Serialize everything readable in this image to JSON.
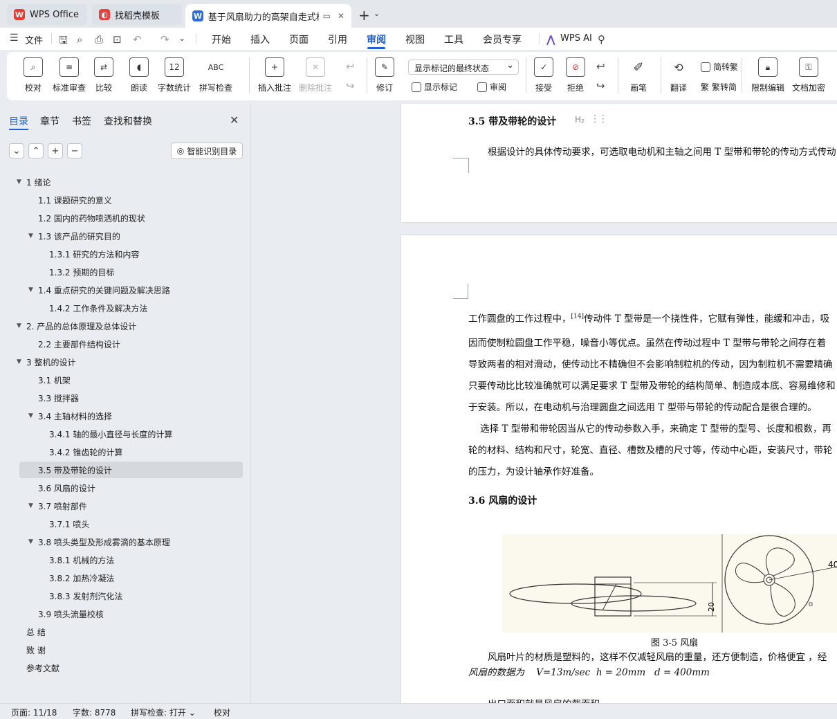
{
  "tabs": [
    {
      "label": "WPS Office"
    },
    {
      "label": "找稻壳模板"
    },
    {
      "label": "基于风扇助力的高架自走式棉花"
    }
  ],
  "menubar": {
    "file": "文件",
    "items": [
      "开始",
      "插入",
      "页面",
      "引用",
      "审阅",
      "视图",
      "工具",
      "会员专享"
    ],
    "active": "审阅",
    "ai": "WPS AI"
  },
  "ribbon": {
    "proofread": "校对",
    "std_review": "标准审查",
    "compare": "比较",
    "read_aloud": "朗读",
    "word_count": "字数统计",
    "spell_check": "拼写检查",
    "insert_comment": "插入批注",
    "delete_comment": "删除批注",
    "track": "修订",
    "markup_select": "显示标记的最终状态",
    "show_markup": "显示标记",
    "review": "审阅",
    "accept": "接受",
    "reject": "拒绝",
    "pen": "画笔",
    "translate": "翻译",
    "to_trad": "简转繁",
    "to_simp": "繁转简",
    "restrict": "限制编辑",
    "encrypt": "文档加密",
    "trad_icon_text": "繁",
    "count_icon_text": "12",
    "abc_icon_text": "ABC"
  },
  "nav": {
    "tabs": [
      "目录",
      "章节",
      "书签",
      "查找和替换"
    ],
    "smart_toc": "智能识别目录",
    "toc": [
      {
        "label": "1  绪论",
        "level": 0,
        "twisty": true
      },
      {
        "label": "1.1 课题研究的意义",
        "level": 1,
        "twisty": false
      },
      {
        "label": "1.2 国内的药物喷洒机的现状",
        "level": 1,
        "twisty": false
      },
      {
        "label": "1.3  该产品的研究目的",
        "level": 1,
        "twisty": true
      },
      {
        "label": "1.3.1  研究的方法和内容",
        "level": 2,
        "twisty": false
      },
      {
        "label": "1.3.2 预期的目标",
        "level": 2,
        "twisty": false
      },
      {
        "label": "1.4 重点研究的关键问题及解决思路",
        "level": 1,
        "twisty": true
      },
      {
        "label": "1.4.2 工作条件及解决方法",
        "level": 2,
        "twisty": false
      },
      {
        "label": "2.  产品的总体原理及总体设计",
        "level": 0,
        "twisty": true
      },
      {
        "label": "2.2  主要部件结构设计",
        "level": 1,
        "twisty": false
      },
      {
        "label": "3  整机的设计",
        "level": 0,
        "twisty": true
      },
      {
        "label": "3.1  机架",
        "level": 1,
        "twisty": false
      },
      {
        "label": "3.3  搅拌器",
        "level": 1,
        "twisty": false
      },
      {
        "label": "3.4  主轴材料的选择",
        "level": 1,
        "twisty": true
      },
      {
        "label": "3.4.1  轴的最小直径与长度的计算",
        "level": 2,
        "twisty": false
      },
      {
        "label": "3.4.2  锥齿轮的计算",
        "level": 2,
        "twisty": false
      },
      {
        "label": "3.5  带及带轮的设计",
        "level": 1,
        "twisty": false
      },
      {
        "label": "3.6  风扇的设计",
        "level": 1,
        "twisty": false
      },
      {
        "label": "3.7 喷射部件",
        "level": 1,
        "twisty": true
      },
      {
        "label": "3.7.1  喷头",
        "level": 2,
        "twisty": false
      },
      {
        "label": "3.8 喷头类型及形成雾滴的基本原理",
        "level": 1,
        "twisty": true
      },
      {
        "label": "3.8.1  机械的方法",
        "level": 2,
        "twisty": false
      },
      {
        "label": "3.8.2  加热冷凝法",
        "level": 2,
        "twisty": false
      },
      {
        "label": "3.8.3  发射剂汽化法",
        "level": 2,
        "twisty": false
      },
      {
        "label": "3.9  喷头流量校核",
        "level": 1,
        "twisty": false
      },
      {
        "label": "总   结",
        "level": 0,
        "twisty": false
      },
      {
        "label": "致   谢",
        "level": 0,
        "twisty": false
      },
      {
        "label": "参考文献",
        "level": 0,
        "twisty": false
      }
    ],
    "selected_index": 16
  },
  "doc": {
    "h35": "3.5  带及带轮的设计",
    "h2tag": "H₂",
    "p1": "根据设计的具体传动要求，可选取电动机和主轴之间用 T 型带和带轮的传动方式传动",
    "para_lines": [
      "工作圆盘的工作过程中，",
      "因而使制粒圆盘工作平稳，噪音小等优点。虽然在传动过程中 T 型带与带轮之间存在着",
      "导致两者的相对滑动，使传动比不精确但不会影响制粒机的传动，因为制粒机不需要精确",
      "只要传动比比较准确就可以满足要求 T 型带及带轮的结构简单、制造成本底、容易维修和",
      "于安装。所以，在电动机与治理圆盘之间选用 T 型带与带轮的传动配合是很合理的。",
      "    选择 T 型带和带轮因当从它的传动参数入手，来确定 T 型带的型号、长度和根数，再",
      "轮的材料、结构和尺寸，轮宽、直径、槽数及槽的尺寸等，传动中心距，安装尺寸，带轮",
      "的压力，为设计轴承作好准备。"
    ],
    "cite": "[14]",
    "line0_rest": "传动件 T 型带是一个挠性件，它赋有弹性，能缓和冲击，吸",
    "h36": "3.6  风扇的设计",
    "fig_caption": "图 3-5  风扇",
    "dim_20": "20",
    "dim_40": "40",
    "p_fan1": "风扇叶片的材质是塑料的，这样不仅减轻风扇的重量，还方便制造，价格便宜 ，经",
    "p_fan2": "风扇的数据为    V=13m/sec  h = 20mm   d = 400mm",
    "p_next": "出口面积就是风扇的截面积"
  },
  "status": {
    "page": "页面: 11/18",
    "words": "字数: 8778",
    "spell": "拼写检查: 打开",
    "proof": "校对"
  }
}
